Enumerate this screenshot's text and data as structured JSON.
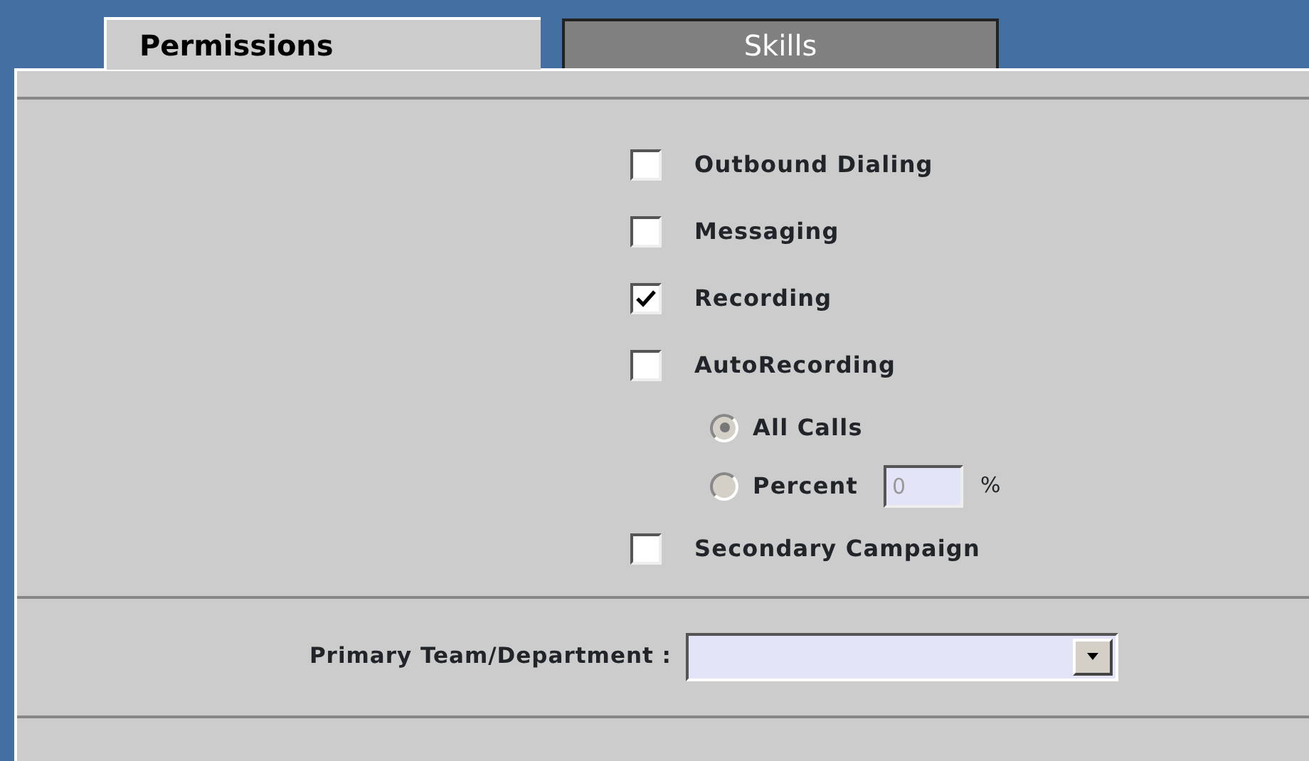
{
  "tabs": [
    {
      "label": "Permissions",
      "selected": true
    },
    {
      "label": "Skills",
      "selected": false
    }
  ],
  "options": [
    {
      "kind": "checkbox",
      "label": "Outbound Dialing",
      "checked": false
    },
    {
      "kind": "checkbox",
      "label": "Messaging",
      "checked": false
    },
    {
      "kind": "checkbox",
      "label": "Recording",
      "checked": true
    },
    {
      "kind": "checkbox",
      "label": "AutoRecording",
      "checked": false
    },
    {
      "kind": "radio",
      "label": "All Calls",
      "selected": true,
      "disabled": true
    },
    {
      "kind": "radio",
      "label": "Percent",
      "selected": false,
      "disabled": true,
      "field": {
        "value": "0",
        "disabled": true
      },
      "unit": "%"
    },
    {
      "kind": "checkbox",
      "label": "Secondary Campaign",
      "checked": false
    }
  ],
  "primary_team": {
    "label": "Primary Team/Department :"
  }
}
